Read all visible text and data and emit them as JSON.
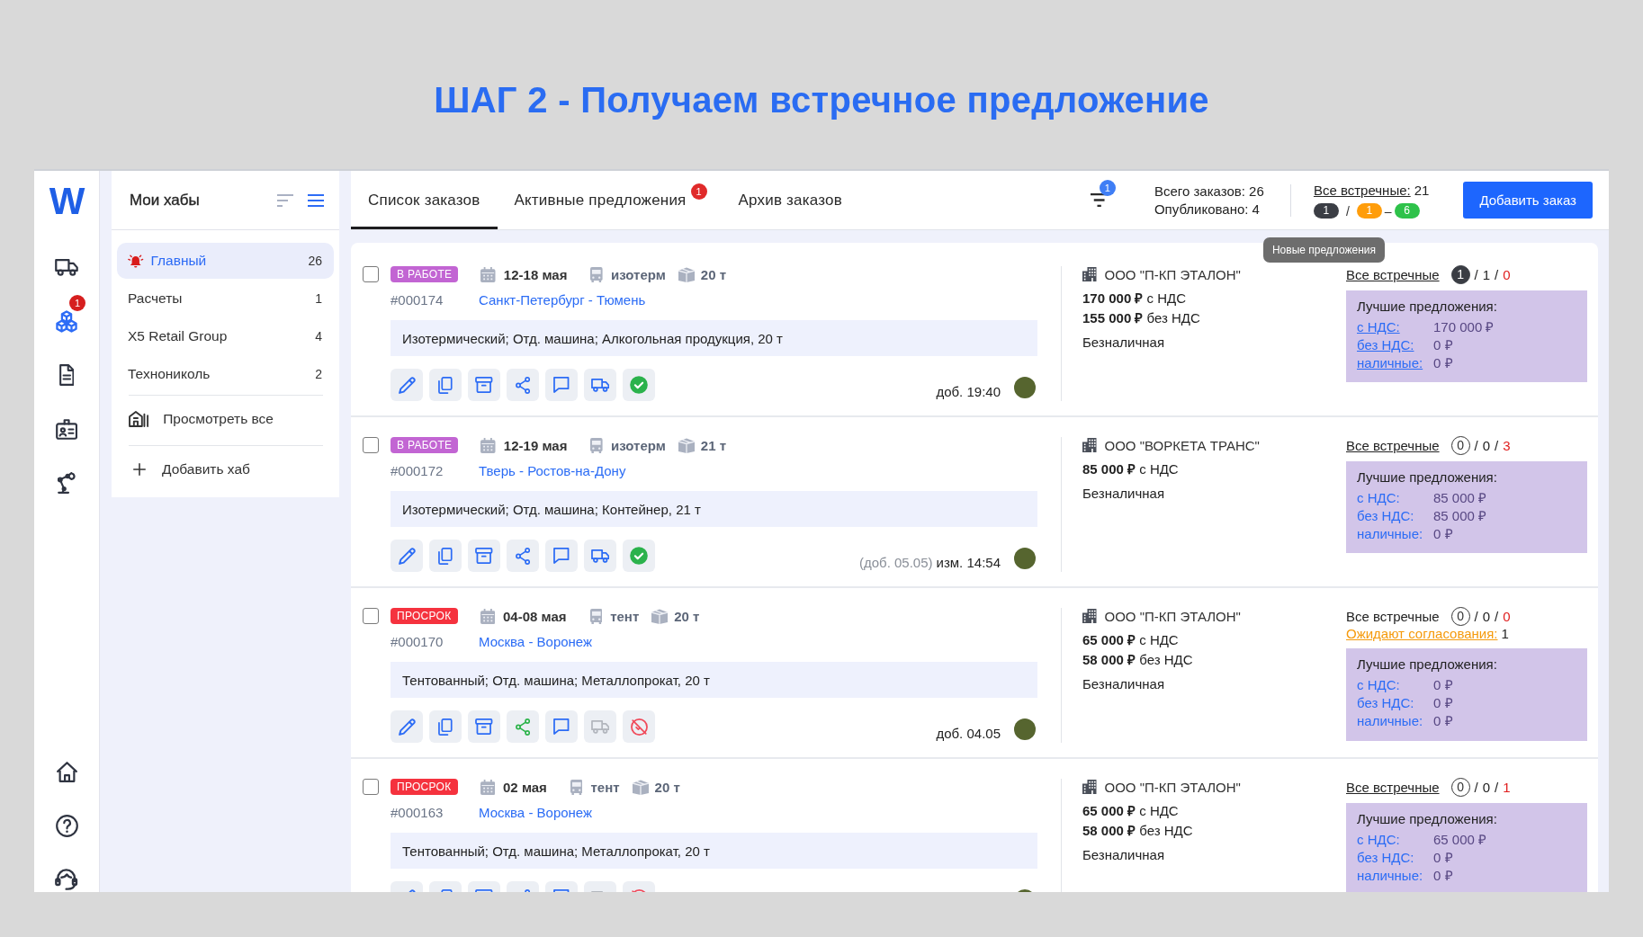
{
  "heading": "ШАГ 2 - Получаем встречное предложение",
  "rail": {
    "logo": "W",
    "items": [
      {
        "selected": false
      },
      {
        "selected": true,
        "badge": "1"
      },
      {
        "selected": false
      },
      {
        "selected": false
      },
      {
        "selected": false
      }
    ],
    "footer_items": [
      {
        "selected": false
      },
      {
        "selected": false
      },
      {
        "selected": false
      }
    ]
  },
  "hubs": {
    "title": "Мои хабы",
    "view_options": [
      {
        "selected": false
      },
      {
        "selected": true
      }
    ],
    "items": [
      {
        "label": "Главный",
        "count": "26",
        "selected": true,
        "alert": true
      },
      {
        "label": "Расчеты",
        "count": "1",
        "selected": false,
        "alert": false
      },
      {
        "label": "X5 Retail Group",
        "count": "4",
        "selected": false,
        "alert": false
      },
      {
        "label": "Технониколь",
        "count": "2",
        "selected": false,
        "alert": false
      }
    ],
    "actions": [
      {
        "label": "Просмотреть все"
      },
      {
        "label": "Добавить хаб"
      }
    ]
  },
  "toolbar": {
    "tabs": [
      {
        "label": "Список заказов",
        "selected": true
      },
      {
        "label": "Активные предложения",
        "selected": false,
        "badge": "1"
      },
      {
        "label": "Архив заказов",
        "selected": false
      }
    ],
    "filter_badge": "1",
    "stats": [
      "Всего заказов: 26",
      "Опубликовано: 4"
    ],
    "counter_offers": {
      "label": "Все встречные:",
      "total": "21",
      "pills": [
        {
          "value": "1",
          "color": "#3b3e45"
        },
        {
          "value": "1",
          "color": "#ff9d0b"
        },
        {
          "value": "6",
          "color": "#2ec24a"
        }
      ],
      "separators": [
        "/",
        "–"
      ]
    },
    "tooltip": "Новые предложения",
    "add_button": "Добавить заказ"
  },
  "orders": [
    {
      "checked": false,
      "status": {
        "label": "В РАБОТЕ",
        "color": "#c265d3"
      },
      "dates": "12-18 мая",
      "vehicle": "изотерм",
      "weight": "20 т",
      "number": "#000174",
      "route": "Санкт-Петербург - Тюмень",
      "description": "Изотермический; Отд. машина; Алкогольная продукция, 20 т",
      "shared": false,
      "vehicle_disabled": false,
      "approved": true,
      "meta": [
        {
          "text": "доб. 19:40",
          "muted": false
        }
      ],
      "company": "ООО \"П-КП ЭТАЛОН\"",
      "prices": [
        "**170 000 ₽** с НДС",
        "**155 000 ₽** без НДС"
      ],
      "payment": "Безналичная",
      "offers": {
        "label": "Все встречные",
        "linked": true,
        "tally": {
          "circled": "1",
          "filled": true,
          "separators": [
            "/",
            "/"
          ],
          "middle": "1",
          "last": "0"
        },
        "best": {
          "title": "Лучшие предложения:",
          "linked": true,
          "rows": [
            {
              "label": "с НДС:",
              "value": "170 000 ₽"
            },
            {
              "label": "без НДС:",
              "value": "0 ₽"
            },
            {
              "label": "наличные:",
              "value": "0 ₽"
            }
          ]
        }
      }
    },
    {
      "checked": false,
      "status": {
        "label": "В РАБОТЕ",
        "color": "#c265d3"
      },
      "dates": "12-19 мая",
      "vehicle": "изотерм",
      "weight": "21 т",
      "number": "#000172",
      "route": "Тверь - Ростов-на-Дону",
      "description": "Изотермический; Отд. машина; Контейнер, 21 т",
      "shared": false,
      "vehicle_disabled": false,
      "approved": true,
      "meta": [
        {
          "text": "(доб. 05.05)",
          "muted": true
        },
        {
          "text": "изм. 14:54",
          "muted": false
        }
      ],
      "company": "ООО \"ВОРКЕТА ТРАНС\"",
      "prices": [
        "**85 000 ₽** с НДС"
      ],
      "payment": "Безналичная",
      "offers": {
        "label": "Все встречные",
        "linked": true,
        "tally": {
          "circled": "0",
          "filled": false,
          "separators": [
            "/",
            "/"
          ],
          "middle": "0",
          "last": "3"
        },
        "best": {
          "title": "Лучшие предложения:",
          "linked": false,
          "rows": [
            {
              "label": "с НДС:",
              "value": "85 000 ₽"
            },
            {
              "label": "без НДС:",
              "value": "85 000 ₽"
            },
            {
              "label": "наличные:",
              "value": "0 ₽"
            }
          ]
        }
      }
    },
    {
      "checked": false,
      "status": {
        "label": "ПРОСРОК",
        "color": "#f5323e"
      },
      "dates": "04-08 мая",
      "vehicle": "тент",
      "weight": "20 т",
      "number": "#000170",
      "route": "Москва - Воронеж",
      "description": "Тентованный; Отд. машина; Металлопрокат, 20 т",
      "shared": true,
      "vehicle_disabled": true,
      "approved": false,
      "meta": [
        {
          "text": "доб. 04.05",
          "muted": false
        }
      ],
      "company": "ООО \"П-КП ЭТАЛОН\"",
      "prices": [
        "**65 000 ₽** с НДС",
        "**58 000 ₽** без НДС"
      ],
      "payment": "Безналичная",
      "offers": {
        "label": "Все встречные",
        "linked": false,
        "tally": {
          "circled": "0",
          "filled": false,
          "separators": [
            "/",
            "/"
          ],
          "middle": "0",
          "last": "0"
        },
        "pending": {
          "label": "Ожидают согласования:",
          "count": "1"
        },
        "best": {
          "title": "Лучшие предложения:",
          "linked": false,
          "rows": [
            {
              "label": "с НДС:",
              "value": "0 ₽"
            },
            {
              "label": "без НДС:",
              "value": "0 ₽"
            },
            {
              "label": "наличные:",
              "value": "0 ₽"
            }
          ]
        }
      }
    },
    {
      "checked": false,
      "status": {
        "label": "ПРОСРОК",
        "color": "#f5323e"
      },
      "dates": "02 мая",
      "vehicle": "тент",
      "weight": "20 т",
      "number": "#000163",
      "route": "Москва - Воронеж",
      "description": "Тентованный; Отд. машина; Металлопрокат, 20 т",
      "shared": false,
      "vehicle_disabled": true,
      "approved": false,
      "company": "ООО \"П-КП ЭТАЛОН\"",
      "prices": [
        "**65 000 ₽** с НДС",
        "**58 000 ₽** без НДС"
      ],
      "payment": "Безналичная",
      "offers": {
        "label": "Все встречные",
        "linked": true,
        "tally": {
          "circled": "0",
          "filled": false,
          "separators": [
            "/",
            "/"
          ],
          "middle": "0",
          "last": "1"
        },
        "best": {
          "title": "Лучшие предложения:",
          "linked": false,
          "rows": [
            {
              "label": "с НДС:",
              "value": "65 000 ₽"
            },
            {
              "label": "без НДС:",
              "value": "0 ₽"
            },
            {
              "label": "наличные:",
              "value": "0 ₽"
            }
          ]
        }
      }
    }
  ]
}
